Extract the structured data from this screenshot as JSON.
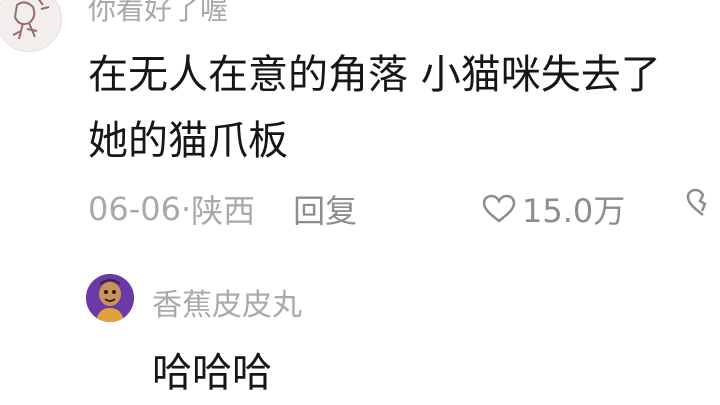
{
  "comment": {
    "username": "你看好了喔",
    "text_lines": [
      "在无人在意的角落 小猫咪失去了",
      "她的猫爪板"
    ],
    "date": "06-06",
    "separator": " · ",
    "location": "陕西",
    "reply_label": "回复",
    "likes": "15.0万",
    "icons": [
      "heart-icon",
      "heart-broken-icon"
    ]
  },
  "reply": {
    "username": "香蕉皮皮丸",
    "text": "哈哈哈"
  }
}
